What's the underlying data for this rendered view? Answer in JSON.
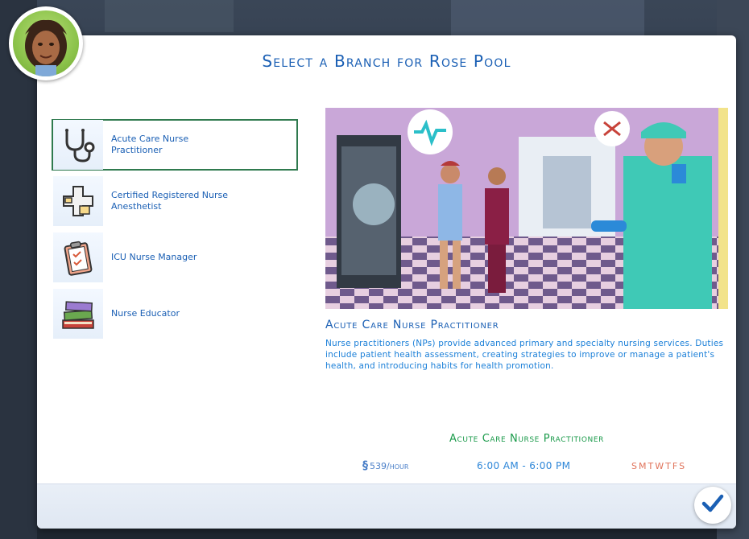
{
  "dialog": {
    "title": "Select a Branch for Rose Pool"
  },
  "branches": [
    {
      "label": "Acute Care Nurse Practitioner",
      "icon": "stethoscope-icon",
      "selected": true
    },
    {
      "label": "Certified Registered Nurse Anesthetist",
      "icon": "medical-cross-icon",
      "selected": false
    },
    {
      "label": "ICU Nurse Manager",
      "icon": "clipboard-icon",
      "selected": false
    },
    {
      "label": "Nurse Educator",
      "icon": "books-icon",
      "selected": false
    }
  ],
  "details": {
    "title": "Acute Care Nurse Practitioner",
    "description": "Nurse practitioners (NPs) provide advanced primary and specialty nursing services. Duties include patient health assessment, creating strategies to improve or manage a patient's health, and introducing habits for health promotion.",
    "summary_name": "Acute Care Nurse Practitioner",
    "pay_amount": "539",
    "pay_unit": "/hour",
    "hours": "6:00 AM - 6:00 PM",
    "days": [
      "S",
      "M",
      "T",
      "W",
      "T",
      "F",
      "S"
    ]
  },
  "colors": {
    "accent_blue": "#1a5fb4",
    "accent_green": "#1a9a4a",
    "selection_border": "#2f7a4e",
    "day_color": "#e0735a"
  }
}
